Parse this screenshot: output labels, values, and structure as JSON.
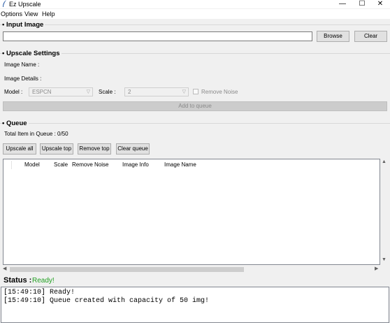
{
  "window": {
    "title": "Ez Upscale",
    "minimize": "—",
    "maximize": "☐",
    "close": "✕"
  },
  "menu": [
    "Options",
    "View",
    "Help"
  ],
  "input_image": {
    "section_title": "Input Image",
    "path_value": "",
    "browse_label": "Browse",
    "clear_label": "Clear"
  },
  "settings": {
    "section_title": "Upscale Settings",
    "image_name_label": "Image Name :",
    "image_details_label": "Image Details :",
    "model_label": "Model :",
    "model_value": "ESPCN",
    "scale_label": "Scale :",
    "scale_value": "2",
    "remove_noise_label": "Remove Noise",
    "add_button": "Add to queue"
  },
  "queue": {
    "section_title": "Queue",
    "total_label": "Total Item in Queue : 0/50",
    "buttons": {
      "upscale_all": "Upscale all",
      "upscale_top": "Upscale top",
      "remove_top": "Remove top",
      "clear_queue": "Clear queue"
    },
    "columns": [
      "Model",
      "Scale",
      "Remove Noise",
      "Image Info",
      "Image Name"
    ]
  },
  "status": {
    "label": "Status :",
    "value": "Ready!",
    "value_color": "#22a022"
  },
  "log": [
    "[15:49:10] Ready!",
    "[15:49:10] Queue created with capacity of 50 img!"
  ]
}
